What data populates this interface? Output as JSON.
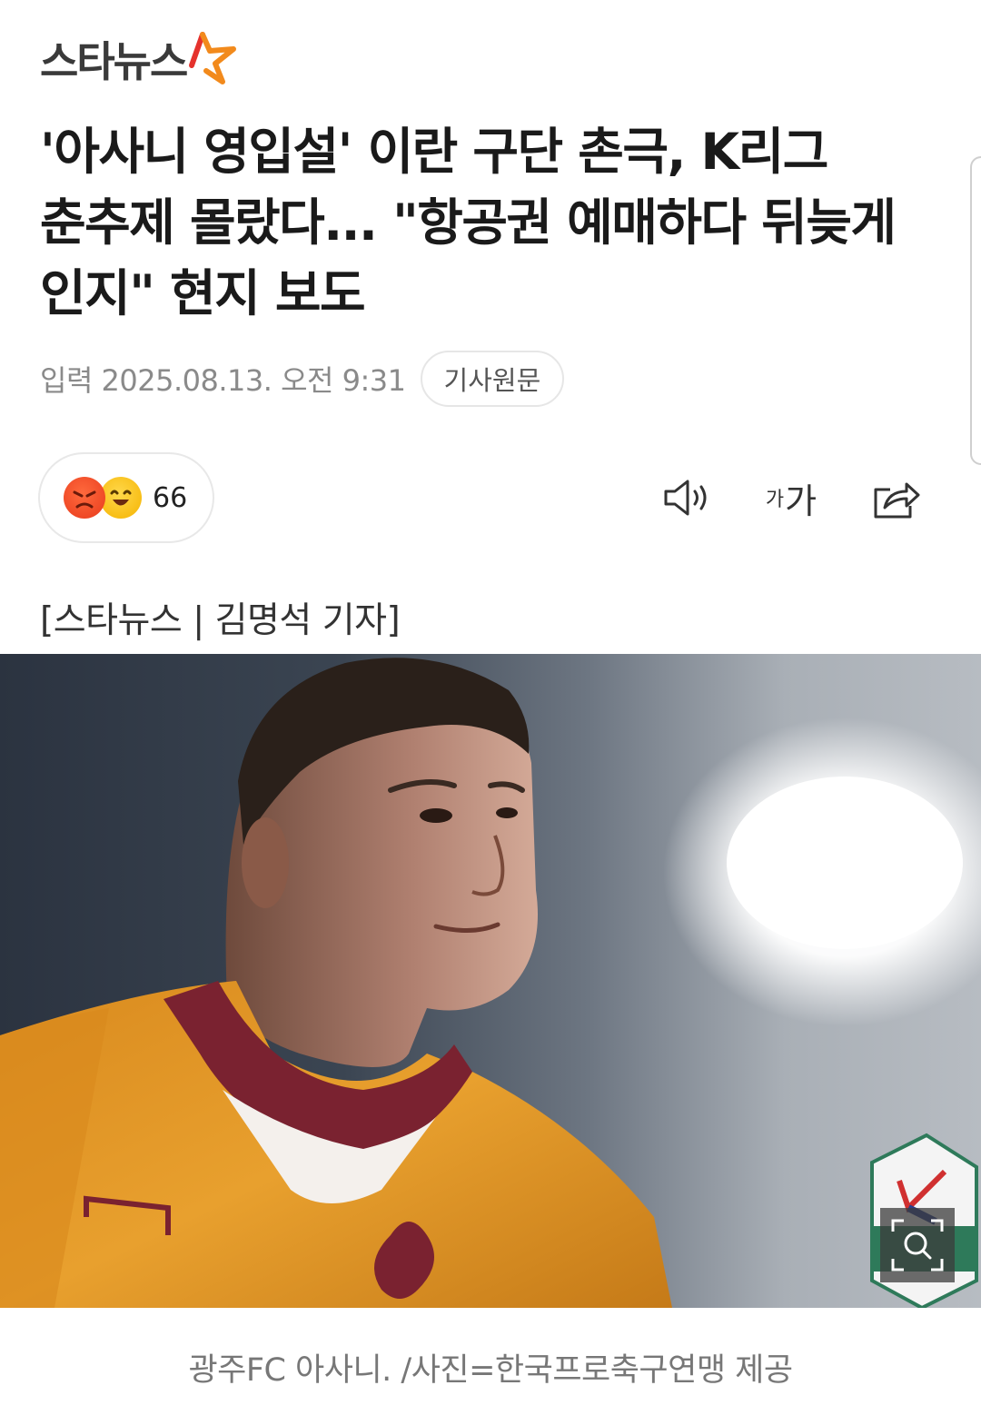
{
  "header": {
    "logo_text": "스타뉴스"
  },
  "article": {
    "title": "'아사니 영입설' 이란 구단 촌극, K리그 춘추제 몰랐다... \"항공권 예매하다 뒤늦게 인지\" 현지 보도",
    "date": "입력 2025.08.13. 오전 9:31",
    "source_button": "기사원문",
    "byline": "[스타뉴스 | 김명석 기자]",
    "caption": "광주FC 아사니. /사진=한국프로축구연맹 제공"
  },
  "reactions": {
    "count": "66",
    "emojis": [
      "angry-face-icon",
      "laughing-face-icon"
    ]
  },
  "toolbar": {
    "font_small": "가",
    "font_large": "가",
    "icons": [
      "speaker-icon",
      "font-size-icon",
      "share-icon"
    ]
  },
  "colors": {
    "logo_text": "#3a3a3a",
    "logo_star_red": "#e5322d",
    "logo_star_orange": "#f28a1c",
    "jersey": "#e8a02e",
    "jersey_collar": "#7a2230"
  }
}
